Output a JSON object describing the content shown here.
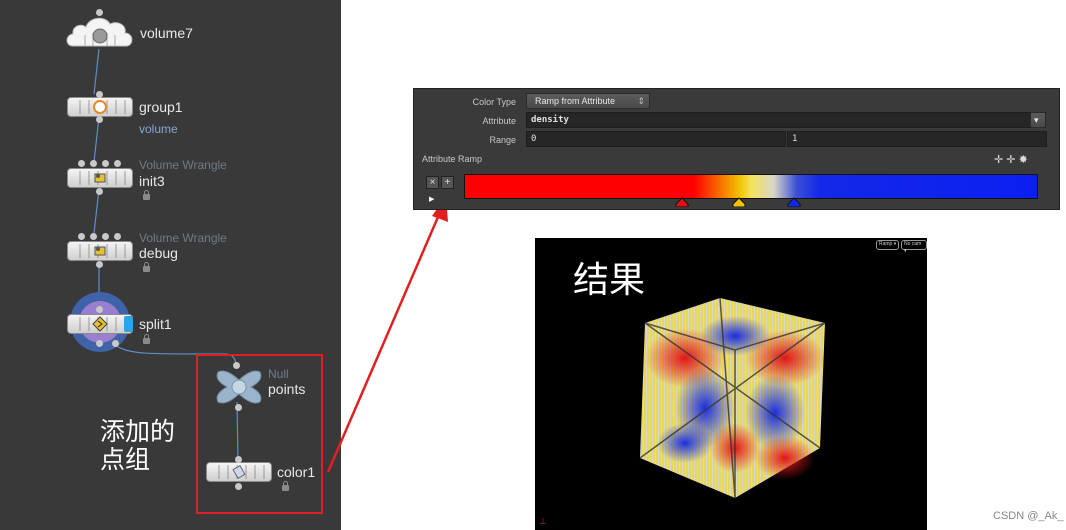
{
  "graph": {
    "nodes": {
      "volume": {
        "name": "volume7"
      },
      "group": {
        "name": "group1",
        "group_label": "volume"
      },
      "init": {
        "type": "Volume Wrangle",
        "name": "init3"
      },
      "debug": {
        "type": "Volume Wrangle",
        "name": "debug"
      },
      "split": {
        "name": "split1"
      },
      "null": {
        "type": "Null",
        "name": "points"
      },
      "color": {
        "name": "color1"
      }
    },
    "annotation": "添加的点组"
  },
  "params": {
    "color_type_label": "Color Type",
    "color_type_value": "Ramp from Attribute",
    "attribute_label": "Attribute",
    "attribute_value": "density",
    "range_label": "Range",
    "range_min": "0",
    "range_max": "1",
    "ramp_label": "Attribute Ramp",
    "ramp_remove": "×",
    "ramp_add": "+"
  },
  "viewport": {
    "title": "结果",
    "menu_ramp": "Ramp ▾",
    "menu_cam": "No cam ▾"
  },
  "colors": {
    "highlight": "#e02020",
    "ramp_red": "#ff0000",
    "ramp_yellow": "#f2c200",
    "ramp_blue": "#0a20f0"
  },
  "watermark": "CSDN @_Ak_"
}
